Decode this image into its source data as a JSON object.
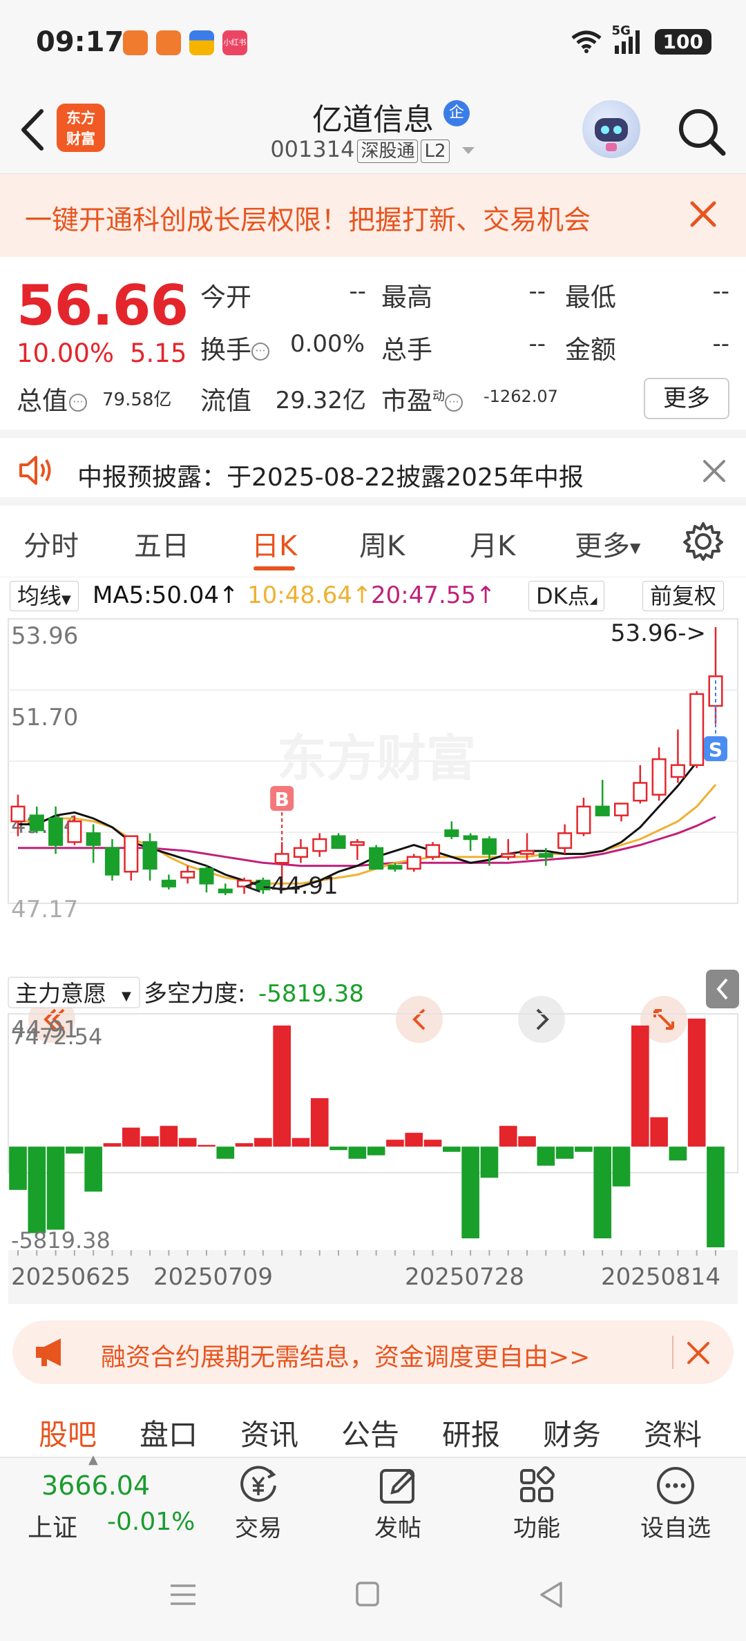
{
  "status": {
    "time": "09:17",
    "network": "5G",
    "battery": "100",
    "notif_colors": [
      "#f07a2e",
      "#f07a2e",
      "#f6b400",
      "#ec4564"
    ],
    "notif_app_text": "小红书"
  },
  "header": {
    "logo_line1": "东方",
    "logo_line2": "财富",
    "stock_name": "亿道信息",
    "enterprise_badge": "企",
    "stock_code": "001314",
    "market_tag": "深股通",
    "level_tag": "L2"
  },
  "promo": {
    "text": "一键开通科创成长层权限！把握打新、交易机会"
  },
  "quote": {
    "price": "56.66",
    "pct": "10.00%",
    "change": "5.15",
    "open_label": "今开",
    "open_val": "--",
    "high_label": "最高",
    "high_val": "--",
    "low_label": "最低",
    "low_val": "--",
    "turnover_label": "换手",
    "turnover_val": "0.00%",
    "volume_label": "总手",
    "volume_val": "--",
    "amount_label": "金额",
    "amount_val": "--",
    "mcap_label": "总值",
    "mcap_val": "79.58亿",
    "float_label": "流值",
    "float_val": "29.32亿",
    "pe_label": "市盈",
    "pe_sup": "动",
    "pe_val": "-1262.07",
    "more_label": "更多"
  },
  "notice": {
    "text": "中报预披露：于2025-08-22披露2025年中报"
  },
  "tabs": [
    "分时",
    "五日",
    "日K",
    "周K",
    "月K",
    "更多"
  ],
  "ma_bar": {
    "type_label": "均线",
    "ma5": "MA5:50.04↑",
    "ma10": "10:48.64↑",
    "ma20": "20:47.55↑",
    "dk_label": "DK点",
    "adjust_label": "前复权"
  },
  "colors": {
    "up": "#e4252b",
    "down": "#18a02a",
    "ma5": "#111111",
    "ma10": "#f0b030",
    "ma20": "#c0207a",
    "accent": "#e8541e"
  },
  "chart_data": [
    {
      "type": "candlestick",
      "y_ticks": [
        "53.96",
        "51.70",
        "49.44",
        "47.17",
        "44.91"
      ],
      "ylim": [
        44.91,
        53.96
      ],
      "max_label": "53.96->",
      "min_label": "<-44.91",
      "buy_marker": "B",
      "sell_marker": "S",
      "watermark": "东方财富",
      "series_ma5": [
        47.3,
        47.3,
        47.6,
        47.7,
        47.5,
        47.2,
        46.7,
        46.5,
        46.3,
        46.1,
        45.9,
        45.6,
        45.4,
        45.2,
        45.1,
        45.2,
        45.4,
        45.7,
        45.9,
        46.2,
        46.4,
        46.6,
        46.4,
        46.2,
        46.0,
        46.1,
        46.3,
        46.4,
        46.4,
        46.3,
        46.3,
        46.4,
        46.7,
        47.2,
        47.9,
        48.6,
        49.4,
        50.04
      ],
      "series_ma10": [
        47.4,
        47.4,
        47.5,
        47.5,
        47.4,
        47.2,
        46.8,
        46.6,
        46.2,
        45.9,
        45.7,
        45.5,
        45.4,
        45.3,
        45.3,
        45.3,
        45.4,
        45.5,
        45.6,
        45.8,
        46.0,
        46.1,
        46.2,
        46.2,
        46.2,
        46.2,
        46.2,
        46.2,
        46.3,
        46.3,
        46.3,
        46.4,
        46.6,
        46.8,
        47.1,
        47.4,
        47.9,
        48.64
      ],
      "series_ma20": [
        46.5,
        46.5,
        46.5,
        46.5,
        46.5,
        46.5,
        46.5,
        46.5,
        46.45,
        46.4,
        46.3,
        46.2,
        46.1,
        46.0,
        45.95,
        45.9,
        45.9,
        45.9,
        45.9,
        45.95,
        46.0,
        46.0,
        46.0,
        46.0,
        46.0,
        46.0,
        46.0,
        46.05,
        46.1,
        46.15,
        46.2,
        46.3,
        46.45,
        46.6,
        46.8,
        47.0,
        47.25,
        47.55
      ],
      "candles": [
        {
          "o": 47.4,
          "h": 48.3,
          "l": 46.9,
          "c": 47.9
        },
        {
          "o": 47.6,
          "h": 47.9,
          "l": 47.0,
          "c": 47.1
        },
        {
          "o": 47.5,
          "h": 47.9,
          "l": 46.3,
          "c": 46.6
        },
        {
          "o": 46.7,
          "h": 47.6,
          "l": 46.6,
          "c": 47.4
        },
        {
          "o": 47.0,
          "h": 47.3,
          "l": 46.0,
          "c": 46.6
        },
        {
          "o": 46.5,
          "h": 46.8,
          "l": 45.4,
          "c": 45.6
        },
        {
          "o": 45.7,
          "h": 46.9,
          "l": 45.4,
          "c": 46.9
        },
        {
          "o": 46.7,
          "h": 47.0,
          "l": 45.4,
          "c": 45.8
        },
        {
          "o": 45.4,
          "h": 45.6,
          "l": 45.1,
          "c": 45.2
        },
        {
          "o": 45.5,
          "h": 45.9,
          "l": 45.3,
          "c": 45.7
        },
        {
          "o": 45.8,
          "h": 45.9,
          "l": 45.0,
          "c": 45.3
        },
        {
          "o": 45.1,
          "h": 45.3,
          "l": 44.91,
          "c": 45.0
        },
        {
          "o": 45.2,
          "h": 45.5,
          "l": 44.95,
          "c": 45.4
        },
        {
          "o": 45.4,
          "h": 45.5,
          "l": 44.95,
          "c": 45.1
        },
        {
          "o": 46.0,
          "h": 46.7,
          "l": 45.2,
          "c": 46.3
        },
        {
          "o": 46.2,
          "h": 46.8,
          "l": 46.0,
          "c": 46.5
        },
        {
          "o": 46.4,
          "h": 47.0,
          "l": 46.2,
          "c": 46.8
        },
        {
          "o": 46.9,
          "h": 47.0,
          "l": 46.5,
          "c": 46.5
        },
        {
          "o": 46.6,
          "h": 46.8,
          "l": 46.1,
          "c": 46.7
        },
        {
          "o": 46.5,
          "h": 46.6,
          "l": 45.8,
          "c": 45.8
        },
        {
          "o": 45.9,
          "h": 46.0,
          "l": 45.7,
          "c": 45.8
        },
        {
          "o": 45.8,
          "h": 46.3,
          "l": 45.7,
          "c": 46.2
        },
        {
          "o": 46.2,
          "h": 46.7,
          "l": 46.1,
          "c": 46.6
        },
        {
          "o": 47.1,
          "h": 47.4,
          "l": 46.8,
          "c": 46.9
        },
        {
          "o": 46.9,
          "h": 47.0,
          "l": 46.4,
          "c": 46.8
        },
        {
          "o": 46.8,
          "h": 46.9,
          "l": 45.9,
          "c": 46.3
        },
        {
          "o": 46.2,
          "h": 46.8,
          "l": 46.1,
          "c": 46.3
        },
        {
          "o": 46.3,
          "h": 47.0,
          "l": 46.1,
          "c": 46.4
        },
        {
          "o": 46.3,
          "h": 46.5,
          "l": 45.9,
          "c": 46.2
        },
        {
          "o": 46.5,
          "h": 47.3,
          "l": 46.3,
          "c": 47.0
        },
        {
          "o": 47.0,
          "h": 48.2,
          "l": 46.9,
          "c": 47.9
        },
        {
          "o": 47.9,
          "h": 48.8,
          "l": 47.6,
          "c": 47.6
        },
        {
          "o": 47.6,
          "h": 48.0,
          "l": 47.4,
          "c": 48.0
        },
        {
          "o": 48.1,
          "h": 49.3,
          "l": 48.0,
          "c": 48.7
        },
        {
          "o": 48.3,
          "h": 49.9,
          "l": 48.1,
          "c": 49.5
        },
        {
          "o": 48.9,
          "h": 50.5,
          "l": 48.7,
          "c": 49.3
        },
        {
          "o": 49.3,
          "h": 51.8,
          "l": 49.2,
          "c": 51.7
        },
        {
          "o": 51.3,
          "h": 53.96,
          "l": 50.7,
          "c": 52.3
        }
      ]
    },
    {
      "type": "bar",
      "title": "主力意愿",
      "indicator_label": "多空力度:",
      "indicator_value": "-5819.38",
      "ylim": [
        -5819.38,
        7472.54
      ],
      "y_ticks": [
        "7472.54",
        "-5819.38"
      ],
      "values": [
        -2500,
        -5000,
        -4800,
        -400,
        -2600,
        200,
        1100,
        600,
        1200,
        500,
        100,
        -700,
        200,
        500,
        7000,
        500,
        2800,
        -200,
        -700,
        -500,
        400,
        800,
        400,
        -300,
        -5300,
        -1800,
        1200,
        600,
        -1100,
        -700,
        -300,
        -5300,
        -2300,
        7000,
        1700,
        -800,
        7400,
        -5819.38
      ],
      "x_labels": [
        "20250625",
        "20250709",
        "20250728",
        "20250814"
      ]
    }
  ],
  "chart_controls": {
    "rewind_icon": "double-left-icon",
    "prev_icon": "chevron-left-icon",
    "next_icon": "chevron-right-icon",
    "expand_icon": "expand-icon"
  },
  "promo2": {
    "text": "融资合约展期无需结息，资金调度更自由>>"
  },
  "bottom_tabs": [
    "股吧",
    "盘口",
    "资讯",
    "公告",
    "研报",
    "财务",
    "资料"
  ],
  "toolbar": {
    "index_value": "3666.04",
    "index_name": "上证",
    "index_pct": "-0.01%",
    "trade_label": "交易",
    "post_label": "发帖",
    "func_label": "功能",
    "watch_label": "设自选"
  }
}
